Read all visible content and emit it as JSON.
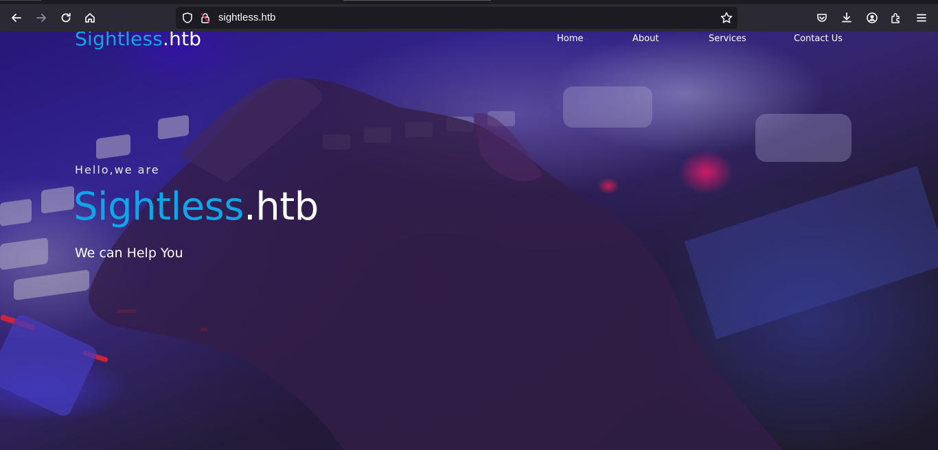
{
  "browser": {
    "url": "sightless.htb",
    "toolbar_icons": [
      "back-arrow-icon",
      "forward-arrow-icon",
      "reload-icon",
      "home-icon",
      "pocket-icon",
      "download-icon",
      "account-icon",
      "extensions-icon",
      "menu-icon"
    ]
  },
  "site": {
    "brand_primary": "Sightless",
    "brand_secondary": ".htb",
    "accent_color": "#0ea5e9",
    "nav": [
      "Home",
      "About",
      "Services",
      "Contact Us"
    ],
    "hero": {
      "greeting": "Hello,we are",
      "title_primary": "Sightless",
      "title_secondary": ".htb",
      "subtitle": "We can Help You"
    }
  }
}
